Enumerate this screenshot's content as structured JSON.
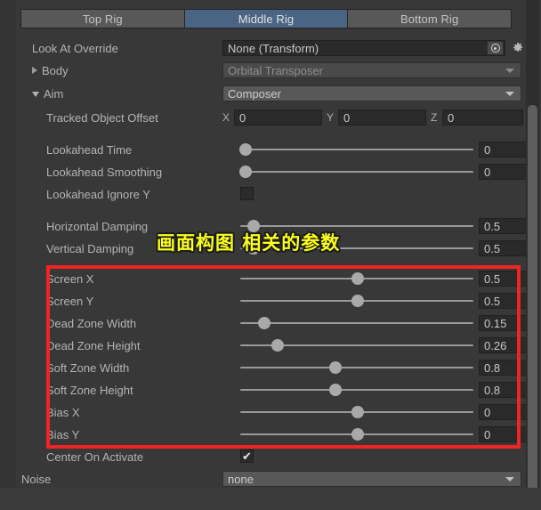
{
  "window": {
    "accent_selected_tab": "#4a6484",
    "annotation_color": "#fbff1e",
    "highlight_box_color": "#f02424"
  },
  "tabs": [
    {
      "label": "Top Rig",
      "selected": false
    },
    {
      "label": "Middle Rig",
      "selected": true
    },
    {
      "label": "Bottom Rig",
      "selected": false
    }
  ],
  "rows": {
    "look_at_override": {
      "label": "Look At Override",
      "value": "None (Transform)",
      "picker_icon": "object-picker-icon",
      "gear_icon": "gear-icon"
    },
    "body": {
      "label": "Body",
      "value": "Orbital Transposer",
      "expanded": false,
      "disabled": true
    },
    "aim": {
      "label": "Aim",
      "value": "Composer",
      "expanded": true,
      "disabled": false
    },
    "tracked_object_offset": {
      "label": "Tracked Object Offset",
      "axes": [
        {
          "axis": "X",
          "value": "0"
        },
        {
          "axis": "Y",
          "value": "0"
        },
        {
          "axis": "Z",
          "value": "0"
        }
      ]
    },
    "lookahead_time": {
      "label": "Lookahead Time",
      "value": "0",
      "fraction": 0.0
    },
    "lookahead_smoothing": {
      "label": "Lookahead Smoothing",
      "value": "0",
      "fraction": 0.0
    },
    "lookahead_ignore_y": {
      "label": "Lookahead Ignore Y",
      "checked": false
    },
    "horizontal_damping": {
      "label": "Horizontal Damping",
      "value": "0.5",
      "fraction": 0.055
    },
    "vertical_damping": {
      "label": "Vertical Damping",
      "value": "0.5",
      "fraction": 0.055
    },
    "screen_x": {
      "label": "Screen X",
      "value": "0.5",
      "fraction": 0.505
    },
    "screen_y": {
      "label": "Screen Y",
      "value": "0.5",
      "fraction": 0.505
    },
    "dead_zone_width": {
      "label": "Dead Zone Width",
      "value": "0.15",
      "fraction": 0.155
    },
    "dead_zone_height": {
      "label": "Dead Zone Height",
      "value": "0.26",
      "fraction": 0.21
    },
    "soft_zone_width": {
      "label": "Soft Zone Width",
      "value": "0.8",
      "fraction": 0.41
    },
    "soft_zone_height": {
      "label": "Soft Zone Height",
      "value": "0.8",
      "fraction": 0.41
    },
    "bias_x": {
      "label": "Bias X",
      "value": "0",
      "fraction": 0.505
    },
    "bias_y": {
      "label": "Bias Y",
      "value": "0",
      "fraction": 0.505
    },
    "center_on_activate": {
      "label": "Center On Activate",
      "checked": true,
      "check_glyph": "✔"
    },
    "noise": {
      "label": "Noise",
      "value": "none"
    }
  },
  "annotation": {
    "text": "画面构图 相关的参数"
  }
}
